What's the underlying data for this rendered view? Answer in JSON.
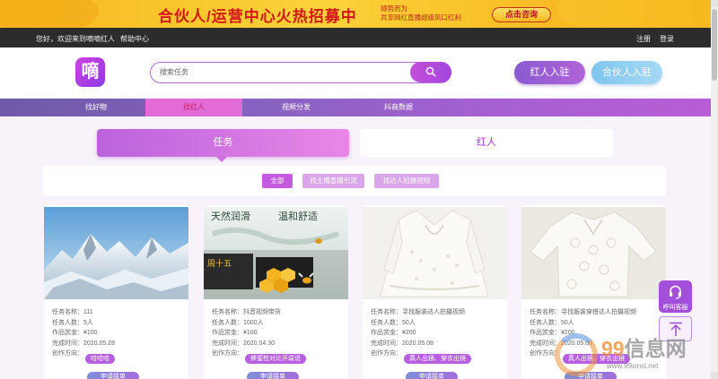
{
  "banner": {
    "headline": "合伙人/运营中心火热招募中",
    "sub_line1": "顺势而为",
    "sub_line2": "共享网红直播超级风口红利",
    "cta": "点击咨询"
  },
  "topbar": {
    "welcome": "您好，欢迎来到嘀嘀红人",
    "help": "帮助中心",
    "register": "注册",
    "login": "登录"
  },
  "header": {
    "logo_text": "嘀",
    "search_placeholder": "搜索任务",
    "influencer_btn": "红人入驻",
    "partner_btn": "合伙人入驻"
  },
  "nav": {
    "items": [
      {
        "label": "找好物"
      },
      {
        "label": "找红人"
      },
      {
        "label": "视频分发"
      },
      {
        "label": "抖商数据"
      }
    ],
    "active_index": 1
  },
  "tabs": {
    "task": "任务",
    "influencer": "红人"
  },
  "filters": [
    {
      "label": "全部",
      "active": true
    },
    {
      "label": "找主播直播引流",
      "active": false
    },
    {
      "label": "找达人拍摄视频",
      "active": false
    }
  ],
  "card_labels": {
    "name": "任务名称：",
    "count": "任务人数：",
    "reward": "作品赏金：",
    "deadline": "完成时间：",
    "direction": "创作方向：",
    "apply": "申请接单"
  },
  "cards": [
    {
      "name": "111",
      "count": "5人",
      "reward": "¥100",
      "deadline": "2020.05.28",
      "tag": "哈哈哈",
      "image": "snowy-mountains"
    },
    {
      "name": "抖音视频带货",
      "count": "1000人",
      "reward": "¥100",
      "deadline": "2020.04.30",
      "tag": "蜂蜜检对比开袋说",
      "image": "honey-product",
      "image_text_1": "天然润滑",
      "image_text_2": "温和舒适",
      "image_text_3": "周十五"
    },
    {
      "name": "寻找服装达人拍摄视频",
      "count": "50人",
      "reward": "¥200",
      "deadline": "2020.05.08",
      "tag": "真人出镜、穿衣出镜",
      "image": "white-lace-blouse"
    },
    {
      "name": "寻找服装穿搭达人拍摄视频",
      "count": "50人",
      "reward": "¥200",
      "deadline": "2020.05.08",
      "tag": "真人出镜、穿衣出镜",
      "image": "white-lace-top"
    }
  ],
  "tools": {
    "service": "呼叫客服"
  },
  "watermark": {
    "digits": "99",
    "word": "信息网",
    "url": "www.99xinxi.net"
  },
  "colors": {
    "accent": "#b65fe2",
    "banner": "#fbd23a",
    "topbar": "#2c2c2c"
  }
}
